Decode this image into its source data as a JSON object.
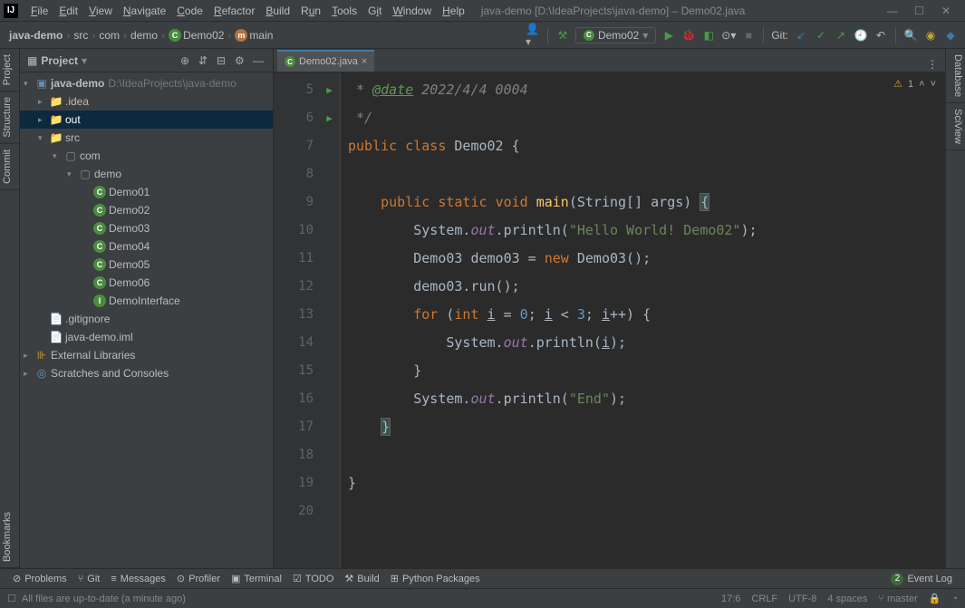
{
  "window": {
    "title": "java-demo [D:\\IdeaProjects\\java-demo] – Demo02.java"
  },
  "menu": [
    "File",
    "Edit",
    "View",
    "Navigate",
    "Code",
    "Refactor",
    "Build",
    "Run",
    "Tools",
    "Git",
    "Window",
    "Help"
  ],
  "breadcrumbs": {
    "project": "java-demo",
    "parts": [
      "src",
      "com",
      "demo"
    ],
    "class": "Demo02",
    "method": "main"
  },
  "runConfig": "Demo02",
  "gitLabel": "Git:",
  "projectPanel": {
    "title": "Project",
    "root": {
      "name": "java-demo",
      "path": "D:\\IdeaProjects\\java-demo"
    },
    "idea": ".idea",
    "out": "out",
    "src": "src",
    "com": "com",
    "demo": "demo",
    "classes": [
      "Demo01",
      "Demo02",
      "Demo03",
      "Demo04",
      "Demo05",
      "Demo06"
    ],
    "interface": "DemoInterface",
    "gitignore": ".gitignore",
    "iml": "java-demo.iml",
    "extLib": "External Libraries",
    "scratches": "Scratches and Consoles"
  },
  "editor": {
    "tabName": "Demo02.java",
    "warnCount": "1",
    "lines": [
      "5",
      "6",
      "7",
      "8",
      "9",
      "10",
      "11",
      "12",
      "13",
      "14",
      "15",
      "16",
      "17",
      "18",
      "19",
      "20"
    ],
    "code": {
      "l5a": " * ",
      "l5tag": "@date",
      "l5b": " 2022/4/4 0004",
      "l6": " */",
      "l7a": "public",
      "l7b": "class",
      "l7c": "Demo02 {",
      "l9a": "public",
      "l9b": "static",
      "l9c": "void",
      "l9d": "main",
      "l9e": "(String[] args) ",
      "l9f": "{",
      "l10a": "System.",
      "l10b": "out",
      "l10c": ".println(",
      "l10d": "\"Hello World! Demo02\"",
      "l10e": ");",
      "l11a": "Demo03 demo03 = ",
      "l11b": "new",
      "l11c": " Demo03();",
      "l12": "demo03.run();",
      "l13a": "for",
      "l13b": " (",
      "l13c": "int",
      "l13d": "i",
      "l13e": " = ",
      "l13f": "0",
      "l13g": "; ",
      "l13h": "i",
      "l13i": " < ",
      "l13j": "3",
      "l13k": "; ",
      "l13l": "i",
      "l13m": "++) {",
      "l14a": "System.",
      "l14b": "out",
      "l14c": ".println(",
      "l14d": "i",
      "l14e": ");",
      "l15": "}",
      "l16a": "System.",
      "l16b": "out",
      "l16c": ".println(",
      "l16d": "\"End\"",
      "l16e": ");",
      "l17": "}",
      "l19": "}"
    }
  },
  "bottomBar": {
    "problems": "Problems",
    "git": "Git",
    "messages": "Messages",
    "profiler": "Profiler",
    "terminal": "Terminal",
    "todo": "TODO",
    "build": "Build",
    "python": "Python Packages",
    "eventCount": "2",
    "eventLog": "Event Log"
  },
  "statusBar": {
    "msg": "All files are up-to-date (a minute ago)",
    "pos": "17:6",
    "lineEnding": "CRLF",
    "encoding": "UTF-8",
    "indent": "4 spaces",
    "branch": "master"
  },
  "leftTabs": {
    "project": "Project",
    "structure": "Structure",
    "commit": "Commit",
    "bookmarks": "Bookmarks"
  },
  "rightTabs": {
    "database": "Database",
    "sciview": "SciView"
  }
}
